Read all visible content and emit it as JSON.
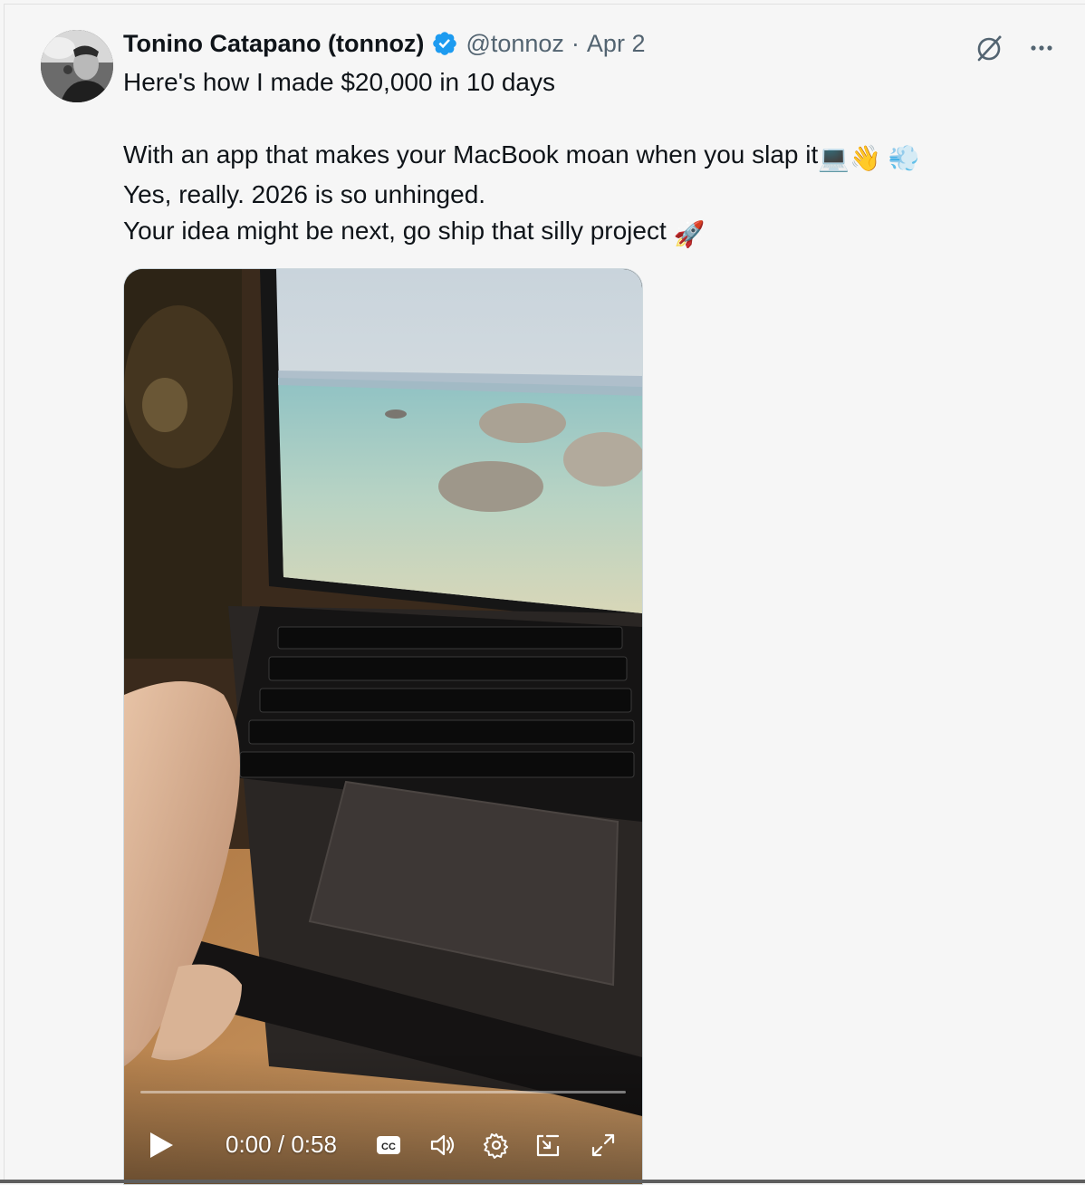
{
  "tweet": {
    "author_name": "Tonino Catapano (tonnoz)",
    "handle": "@tonnoz",
    "separator": "·",
    "date": "Apr 2",
    "lines": {
      "l1": "Here's how I made $20,000 in 10 days",
      "l2_text": "With an app that makes your MacBook moan when you slap it",
      "l2_emojis": "💻👋 💨",
      "l3": "Yes, really. 2026 is so unhinged.",
      "l4_text": "Your idea might be next, go ship that silly project ",
      "l4_emoji": "🚀"
    }
  },
  "video": {
    "current_time": "0:00",
    "time_separator": "/",
    "duration": "0:58",
    "progress": 0,
    "cc_label": "CC"
  },
  "icons": {
    "verified": "verified-badge-icon",
    "grok": "grok-icon",
    "more": "more-icon",
    "play": "play-icon",
    "captions": "captions-icon",
    "volume": "volume-icon",
    "settings": "settings-icon",
    "pip": "picture-in-picture-icon",
    "fullscreen": "fullscreen-icon"
  },
  "colors": {
    "verified_blue": "#1d9bf0",
    "secondary_text": "#536471",
    "primary_text": "#0f1419"
  }
}
